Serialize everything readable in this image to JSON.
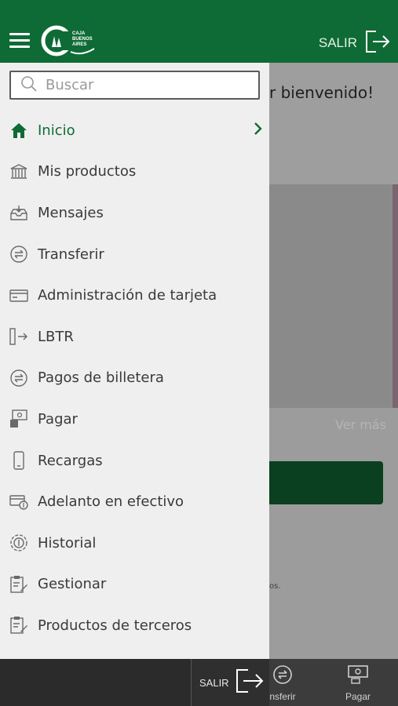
{
  "header": {
    "logo_text": "CAJA\nBUENOS\nAIRES",
    "exit_label": "SALIR"
  },
  "search": {
    "placeholder": "Buscar",
    "value": ""
  },
  "menu": [
    {
      "label": "Inicio",
      "icon": "home-icon",
      "active": true
    },
    {
      "label": "Mis productos",
      "icon": "bank-icon"
    },
    {
      "label": "Mensajes",
      "icon": "inbox-icon"
    },
    {
      "label": "Transferir",
      "icon": "transfer-icon"
    },
    {
      "label": "Administración de tarjeta",
      "icon": "card-icon"
    },
    {
      "label": "LBTR",
      "icon": "lbtr-icon"
    },
    {
      "label": "Pagos de billetera",
      "icon": "wallet-transfer-icon"
    },
    {
      "label": "Pagar",
      "icon": "pay-icon"
    },
    {
      "label": "Recargas",
      "icon": "phone-icon"
    },
    {
      "label": "Adelanto en efectivo",
      "icon": "cash-advance-icon"
    },
    {
      "label": "Historial",
      "icon": "history-icon"
    },
    {
      "label": "Gestionar",
      "icon": "clipboard-edit-icon"
    },
    {
      "label": "Productos de terceros",
      "icon": "clipboard-edit-icon"
    }
  ],
  "background": {
    "welcome_text": "r bienvenido!",
    "ver_mas": "Ver más",
    "tiny_text": "os."
  },
  "bottom_bar": {
    "exit_label": "SALIR",
    "tabs": [
      {
        "label": "nsferir",
        "icon": "transfer-icon"
      },
      {
        "label": "Pagar",
        "icon": "pay-icon"
      }
    ]
  },
  "colors": {
    "brand_green": "#0f6b35",
    "drawer_bg": "#efefef",
    "text": "#3a3a3a"
  }
}
